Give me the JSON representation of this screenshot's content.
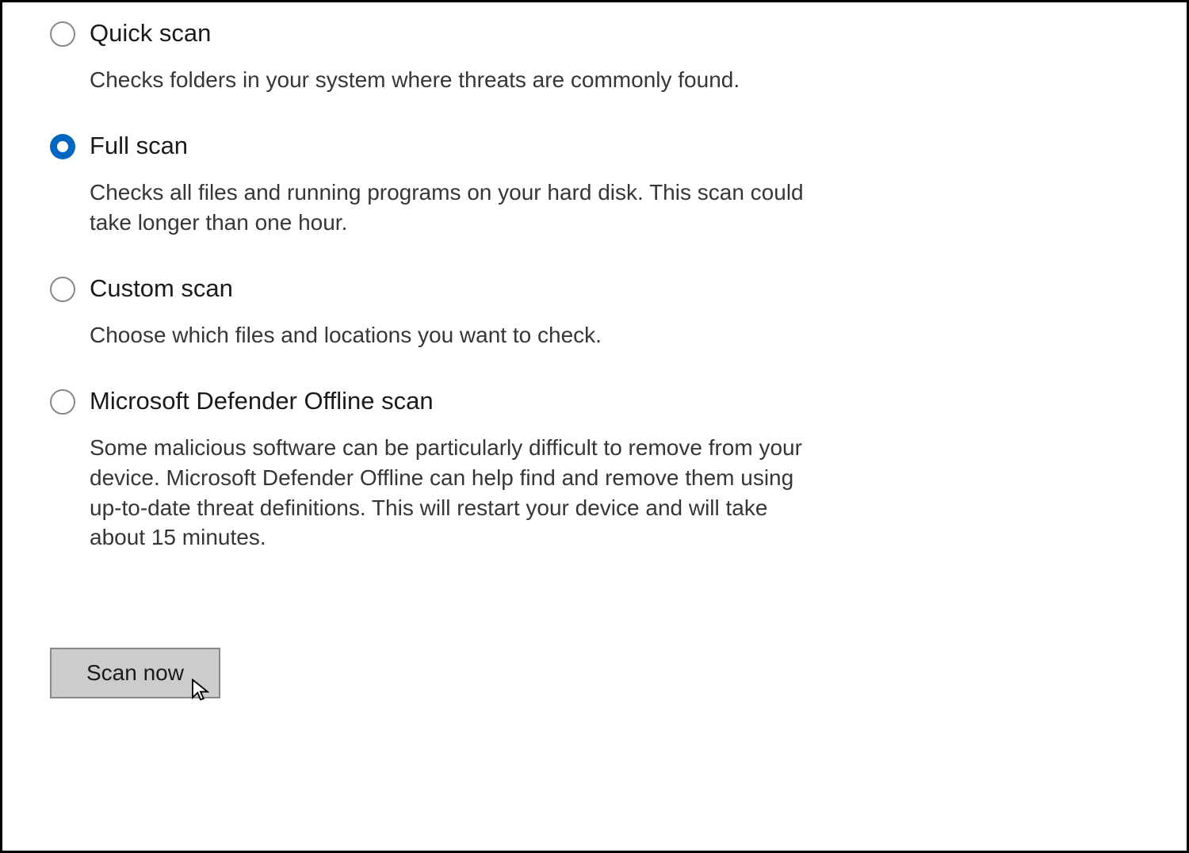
{
  "scan_options": {
    "options": [
      {
        "id": "quick",
        "label": "Quick scan",
        "description": "Checks folders in your system where threats are commonly found.",
        "selected": false
      },
      {
        "id": "full",
        "label": "Full scan",
        "description": "Checks all files and running programs on your hard disk. This scan could take longer than one hour.",
        "selected": true
      },
      {
        "id": "custom",
        "label": "Custom scan",
        "description": "Choose which files and locations you want to check.",
        "selected": false
      },
      {
        "id": "offline",
        "label": "Microsoft Defender Offline scan",
        "description": "Some malicious software can be particularly difficult to remove from your device. Microsoft Defender Offline can help find and remove them using up-to-date threat definitions. This will restart your device and will take about 15 minutes.",
        "selected": false
      }
    ],
    "action_button": "Scan now"
  },
  "colors": {
    "accent": "#0067c0",
    "button_bg": "#cccccc",
    "border": "#888888"
  }
}
